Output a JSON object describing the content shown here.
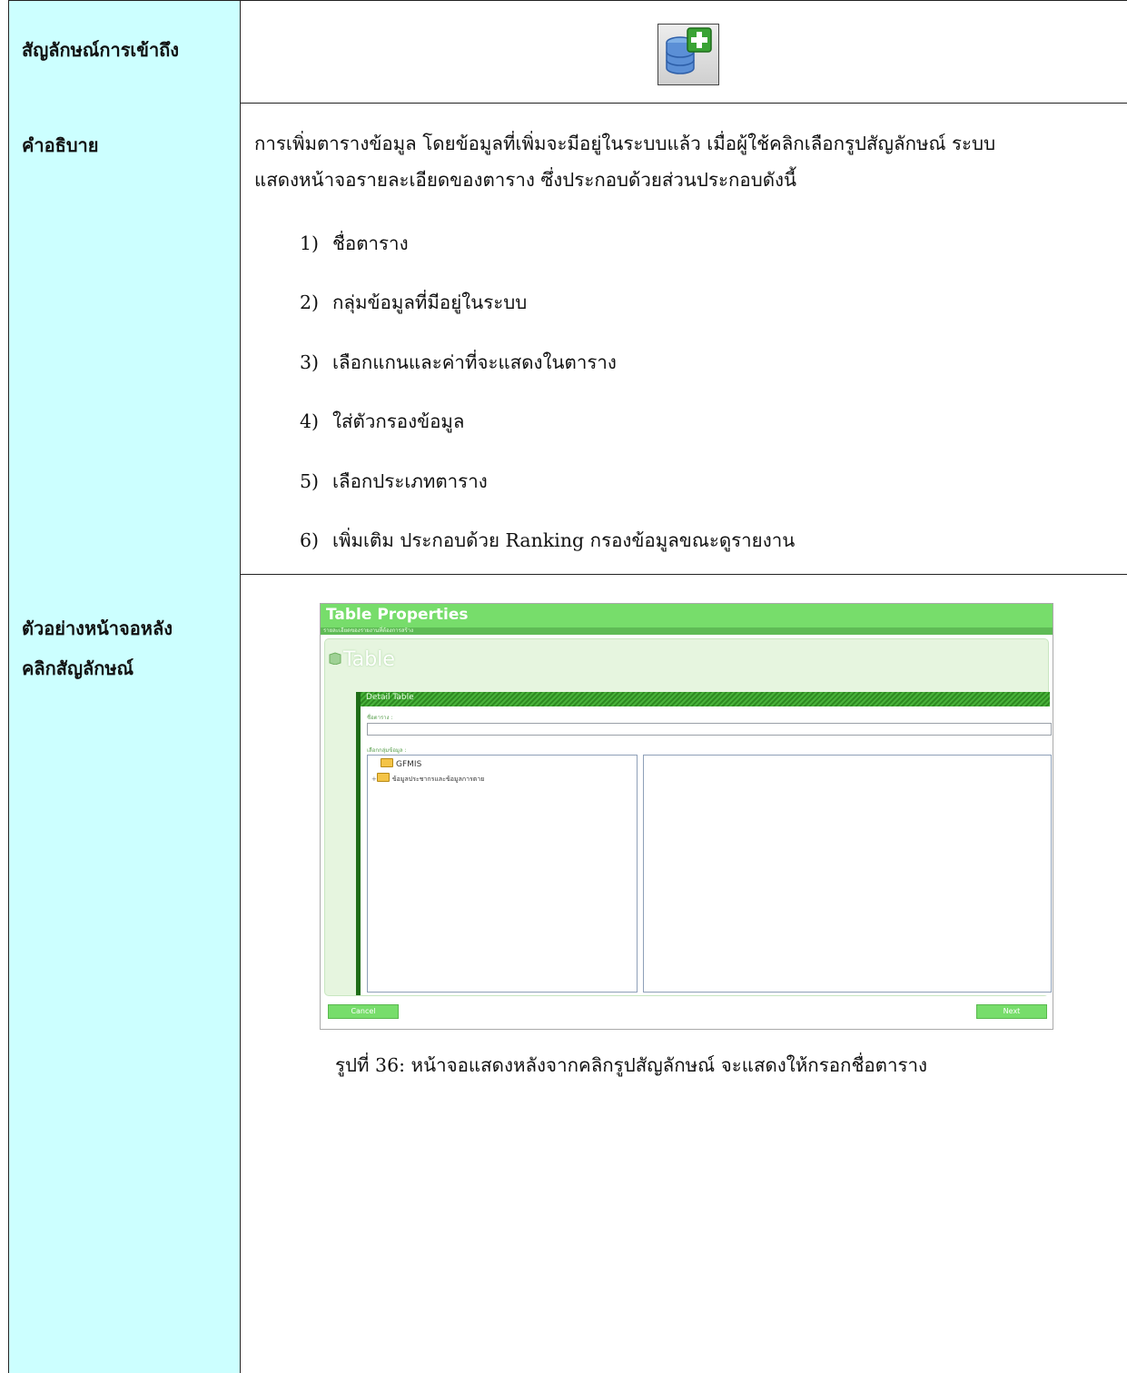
{
  "rows": {
    "access": {
      "label": "สัญลักษณ์การเข้าถึง",
      "icon": "database-add-icon"
    },
    "description": {
      "label": "คำอธิบาย",
      "text_line1": "การเพิ่มตารางข้อมูล โดยข้อมูลที่เพิ่มจะมีอยู่ในระบบแล้ว เมื่อผู้ใช้คลิกเลือกรูปสัญลักษณ์ ระบบ",
      "text_line2": "แสดงหน้าจอรายละเอียดของตาราง ซึ่งประกอบด้วยส่วนประกอบดังนี้",
      "items": [
        {
          "num": "1)",
          "text": "ชื่อตาราง"
        },
        {
          "num": "2)",
          "text": "กลุ่มข้อมูลที่มีอยู่ในระบบ"
        },
        {
          "num": "3)",
          "text": "เลือกแกนและค่าที่จะแสดงในตาราง"
        },
        {
          "num": "4)",
          "text": "ใส่ตัวกรองข้อมูล"
        },
        {
          "num": "5)",
          "text": "เลือกประเภทตาราง"
        },
        {
          "num": "6)",
          "text": "เพิ่มเติม ประกอบด้วย Ranking กรองข้อมูลขณะดูรายงาน"
        }
      ]
    },
    "example": {
      "label_line1": "ตัวอย่างหน้าจอหลัง",
      "label_line2": "คลิกสัญลักษณ์",
      "caption": "รูปที่ 36: หน้าจอแสดงหลังจากคลิกรูปสัญลักษณ์ จะแสดงให้กรอกชื่อตาราง"
    }
  },
  "screenshot": {
    "title": "Table Properties",
    "subtitle": "รายละเอียดของรายงานที่ต้องการสร้าง",
    "heading": "Table",
    "section": "Detail Table",
    "name_label": "ชื่อตาราง :",
    "group_label": "เลือกกลุ่มข้อมูล :",
    "tree_items": [
      "GFMIS",
      "ข้อมูลประชากรและข้อมูลการตาย"
    ],
    "cancel_label": "Cancel",
    "next_label": "Next",
    "colors": {
      "header": "#77dd6b",
      "dark_green": "#1e6d17",
      "label_bg": "#ccffff"
    }
  }
}
